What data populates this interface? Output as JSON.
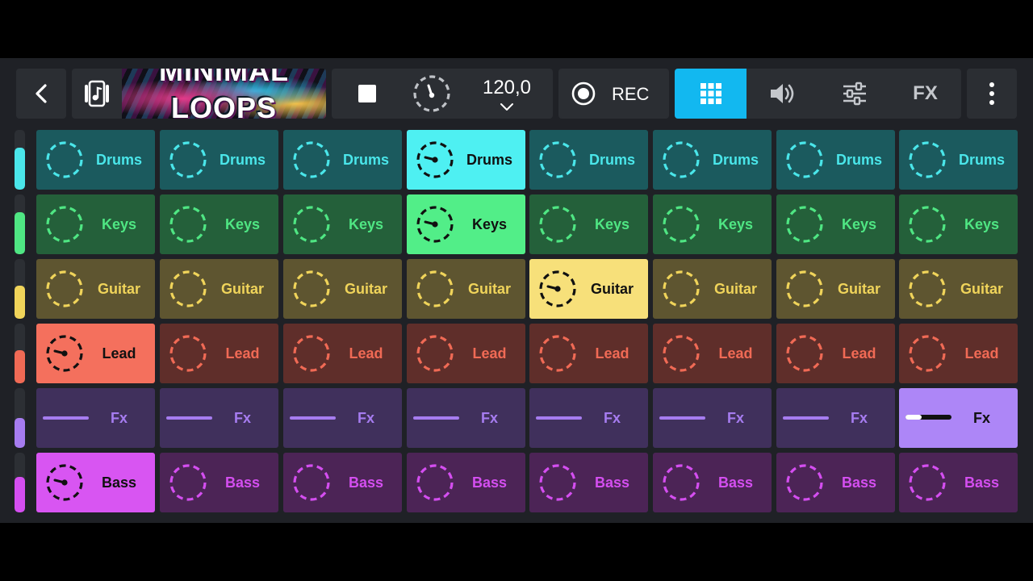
{
  "toolbar": {
    "cover_text_line1": "MINIMAL",
    "cover_text_line2": "LOOPS",
    "tempo_value": "120,0",
    "rec_label": "REC",
    "fx_tab_label": "FX",
    "icons": {
      "back": "back-arrow-icon",
      "library": "library-music-icon",
      "stop": "stop-icon",
      "metronome": "metronome-icon",
      "tempo_chevron": "chevron-down-icon",
      "record": "record-icon",
      "grid": "pad-grid-icon",
      "volume": "volume-icon",
      "mixer": "mixer-icon",
      "menu": "more-vertical-icon"
    },
    "active_tab": "grid"
  },
  "grid": {
    "columns": 8,
    "rows": [
      {
        "label": "Drums",
        "kind": "loop",
        "color": "#4ae6ea",
        "pad_bg": "#1b5a5e",
        "active_bg": "#4ef0f2",
        "level": 0.7,
        "active_col": 3
      },
      {
        "label": "Keys",
        "kind": "loop",
        "color": "#4fe683",
        "pad_bg": "#24603a",
        "active_bg": "#52ee88",
        "level": 0.7,
        "active_col": 3
      },
      {
        "label": "Guitar",
        "kind": "loop",
        "color": "#f0d45a",
        "pad_bg": "#5e5530",
        "active_bg": "#f7e07a",
        "level": 0.55,
        "active_col": 4
      },
      {
        "label": "Lead",
        "kind": "loop",
        "color": "#f06a55",
        "pad_bg": "#5f2e2a",
        "active_bg": "#f4705d",
        "level": 0.55,
        "active_col": 0
      },
      {
        "label": "Fx",
        "kind": "oneshot",
        "color": "#a67cf0",
        "pad_bg": "#40305c",
        "active_bg": "#ad86f7",
        "level": 0.5,
        "active_col": 7
      },
      {
        "label": "Bass",
        "kind": "loop",
        "color": "#d44ef0",
        "pad_bg": "#4c2456",
        "active_bg": "#d855f2",
        "level": 0.6,
        "active_col": 0
      }
    ]
  }
}
